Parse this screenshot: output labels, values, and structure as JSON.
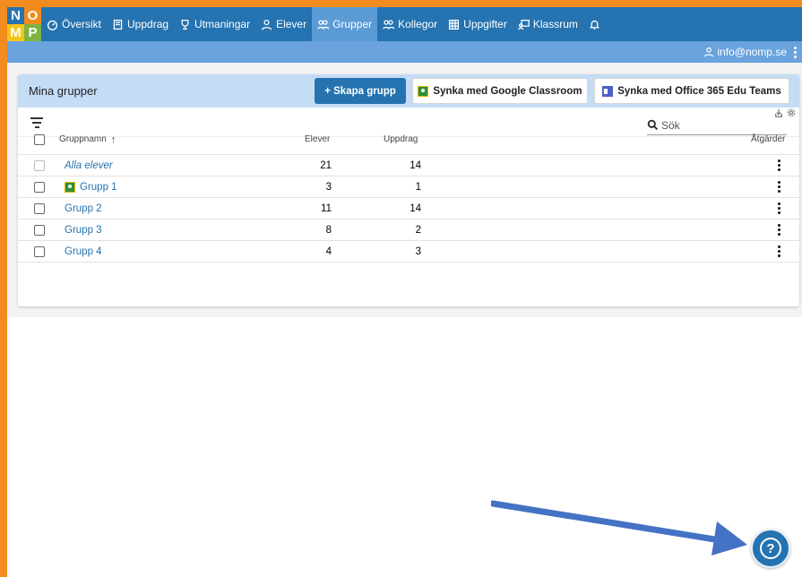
{
  "logo": {
    "letters": [
      "N",
      "O",
      "M",
      "P"
    ],
    "colors": [
      "#2573b0",
      "#f28c1e",
      "#f5c518",
      "#7cb342"
    ]
  },
  "nav": {
    "items": [
      {
        "label": "Översikt",
        "icon": "dashboard-icon"
      },
      {
        "label": "Uppdrag",
        "icon": "book-icon"
      },
      {
        "label": "Utmaningar",
        "icon": "trophy-icon"
      },
      {
        "label": "Elever",
        "icon": "user-icon"
      },
      {
        "label": "Grupper",
        "icon": "users-icon",
        "active": true
      },
      {
        "label": "Kollegor",
        "icon": "users-icon"
      },
      {
        "label": "Uppgifter",
        "icon": "grid-icon"
      },
      {
        "label": "Klassrum",
        "icon": "classroom-icon"
      }
    ],
    "bell_icon": "bell-icon"
  },
  "user": {
    "email": "info@nomp.se",
    "icon": "user-icon",
    "menu_icon": "kebab-icon"
  },
  "page": {
    "title": "Mina grupper",
    "create_button": "+ Skapa grupp",
    "google_button": "Synka med Google Classroom",
    "office_button": "Synka med Office 365 Edu Teams"
  },
  "toolbar": {
    "filter_icon": "filter-icon",
    "search_placeholder": "Sök",
    "search_icon": "search-icon"
  },
  "table": {
    "headers": {
      "name": "Gruppnamn",
      "students": "Elever",
      "assignments": "Uppdrag",
      "actions": "Åtgärder"
    },
    "sort_icon": "arrow-up-icon",
    "rows": [
      {
        "name": "Alla elever",
        "students": "21",
        "assignments": "14",
        "italic": true,
        "google": false
      },
      {
        "name": "Grupp 1",
        "students": "3",
        "assignments": "1",
        "italic": false,
        "google": true
      },
      {
        "name": "Grupp 2",
        "students": "11",
        "assignments": "14",
        "italic": false,
        "google": false
      },
      {
        "name": "Grupp 3",
        "students": "8",
        "assignments": "2",
        "italic": false,
        "google": false
      },
      {
        "name": "Grupp 4",
        "students": "4",
        "assignments": "3",
        "italic": false,
        "google": false
      }
    ]
  },
  "help": {
    "label": "?",
    "icon": "help-icon"
  },
  "colors": {
    "brand": "#2573b0",
    "nav_active": "#5b9bd5",
    "subbar": "#6aa3dd",
    "card_header": "#c5dcf5",
    "frame": "#f28c1e",
    "annotation_arrow": "#4472c4"
  }
}
